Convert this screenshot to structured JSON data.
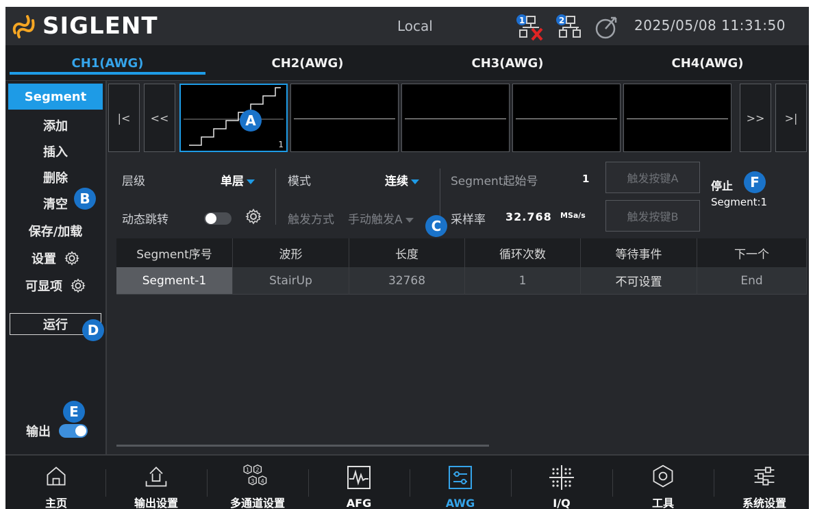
{
  "topbar": {
    "brand": "SIGLENT",
    "status": "Local",
    "net1_badge": "1",
    "net2_badge": "2",
    "datetime": "2025/05/08 11:31:50"
  },
  "channels": [
    {
      "label": "CH1(AWG)",
      "active": true
    },
    {
      "label": "CH2(AWG)",
      "active": false
    },
    {
      "label": "CH3(AWG)",
      "active": false
    },
    {
      "label": "CH4(AWG)",
      "active": false
    }
  ],
  "menu": {
    "segment": "Segment",
    "add": "添加",
    "insert": "插入",
    "delete": "删除",
    "clear": "清空",
    "save_load": "保存/加载",
    "settings": "设置",
    "visible": "可显项",
    "run": "运行",
    "output": "输出"
  },
  "nav": {
    "first": "|<",
    "prev": "<<",
    "next": ">>",
    "last": ">|"
  },
  "thumbnails": [
    {
      "number": "1"
    }
  ],
  "controls": {
    "level_label": "层级",
    "level_value": "单层",
    "mode_label": "模式",
    "mode_value": "连续",
    "seg_start_label": "Segment起始号",
    "seg_start_value": "1",
    "dyn_jump_label": "动态跳转",
    "trigger_mode_label": "触发方式",
    "trigger_mode_value": "手动触发A",
    "sample_rate_label": "采样率",
    "sample_rate_value": "32.768",
    "sample_rate_unit": "MSa/s",
    "trig_a": "触发按键A",
    "trig_b": "触发按键B",
    "state": "停止",
    "state_segment": "Segment:1"
  },
  "table": {
    "headers": [
      "Segment序号",
      "波形",
      "长度",
      "循环次数",
      "等待事件",
      "下一个"
    ],
    "rows": [
      [
        "Segment-1",
        "StairUp",
        "32768",
        "1",
        "不可设置",
        "End"
      ]
    ]
  },
  "markers": {
    "a": "A",
    "b": "B",
    "c": "C",
    "d": "D",
    "e": "E",
    "f": "F"
  },
  "bottom_nav": [
    {
      "label": "主页",
      "icon": "home-icon"
    },
    {
      "label": "输出设置",
      "icon": "output-settings-icon"
    },
    {
      "label": "多通道设置",
      "icon": "multichannel-icon"
    },
    {
      "label": "AFG",
      "icon": "afg-icon"
    },
    {
      "label": "AWG",
      "icon": "awg-icon",
      "active": true
    },
    {
      "label": "I/Q",
      "icon": "iq-icon"
    },
    {
      "label": "工具",
      "icon": "tools-icon"
    },
    {
      "label": "系统设置",
      "icon": "system-settings-icon"
    }
  ],
  "colors": {
    "accent": "#1e9be6",
    "background": "#1e2024",
    "marker": "#1a73c9",
    "disconnected": "#e02424"
  }
}
